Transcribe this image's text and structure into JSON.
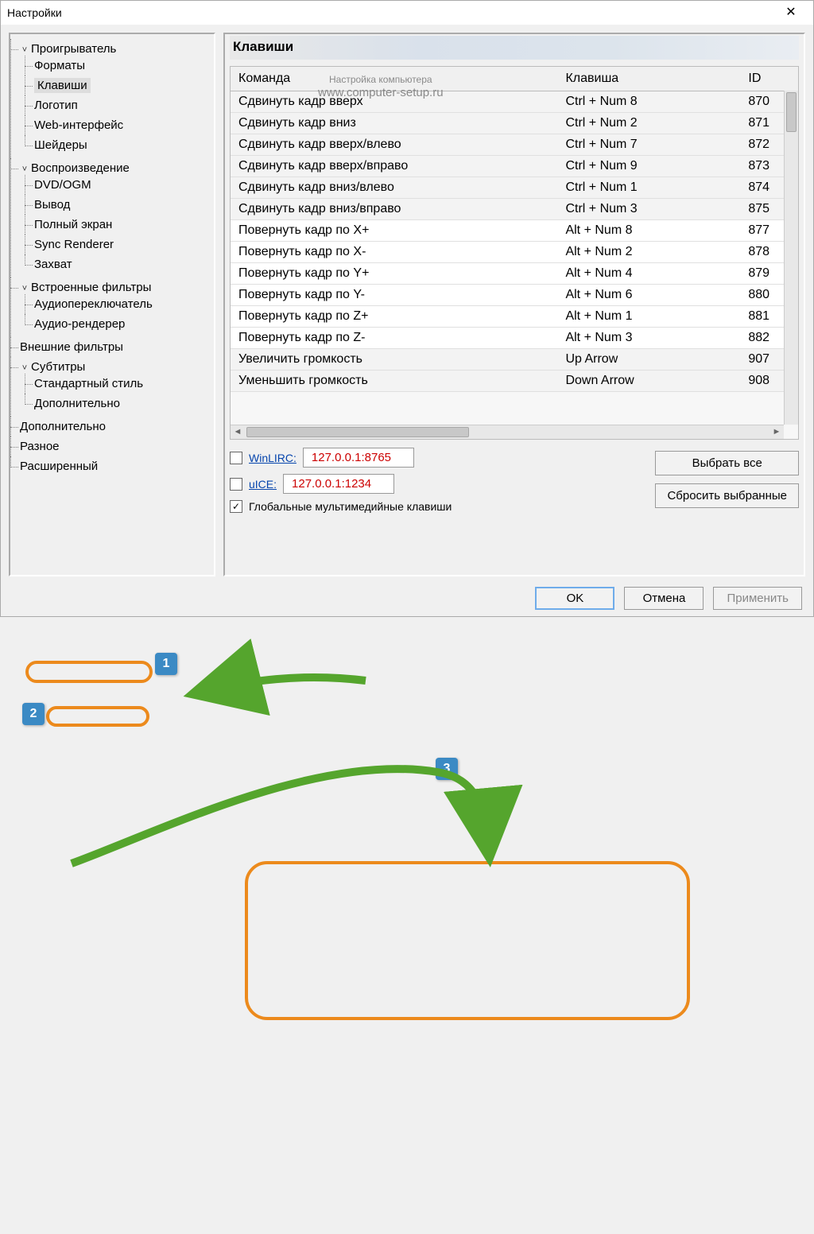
{
  "window": {
    "title": "Настройки"
  },
  "watermark": {
    "line1": "Настройка компьютера",
    "line2": "www.computer-setup.ru"
  },
  "tree": {
    "player": "Проигрыватель",
    "formats": "Форматы",
    "keys": "Клавиши",
    "logo": "Логотип",
    "web": "Web-интерфейс",
    "shaders": "Шейдеры",
    "playback": "Воспроизведение",
    "dvd": "DVD/OGM",
    "output": "Вывод",
    "fullscreen": "Полный экран",
    "sync": "Sync Renderer",
    "capture": "Захват",
    "internal_filters": "Встроенные фильтры",
    "audio_switcher": "Аудиопереключатель",
    "audio_renderer": "Аудио-рендерер",
    "external_filters": "Внешние фильтры",
    "subtitles": "Субтитры",
    "default_style": "Стандартный стиль",
    "sub_advanced": "Дополнительно",
    "advanced": "Дополнительно",
    "misc": "Разное",
    "extended": "Расширенный"
  },
  "section": {
    "title": "Клавиши"
  },
  "table": {
    "headers": {
      "command": "Команда",
      "key": "Клавиша",
      "id": "ID"
    },
    "rows": [
      {
        "cmd": "Сдвинуть кадр вверх",
        "key": "Ctrl + Num 8",
        "id": "870"
      },
      {
        "cmd": "Сдвинуть кадр вниз",
        "key": "Ctrl + Num 2",
        "id": "871"
      },
      {
        "cmd": "Сдвинуть кадр вверх/влево",
        "key": "Ctrl + Num 7",
        "id": "872"
      },
      {
        "cmd": "Сдвинуть кадр вверх/вправо",
        "key": "Ctrl + Num 9",
        "id": "873"
      },
      {
        "cmd": "Сдвинуть кадр вниз/влево",
        "key": "Ctrl + Num 1",
        "id": "874"
      },
      {
        "cmd": "Сдвинуть кадр вниз/вправо",
        "key": "Ctrl + Num 3",
        "id": "875"
      },
      {
        "cmd": "Повернуть кадр по X+",
        "key": "Alt + Num 8",
        "id": "877"
      },
      {
        "cmd": "Повернуть кадр по X-",
        "key": "Alt + Num 2",
        "id": "878"
      },
      {
        "cmd": "Повернуть кадр по Y+",
        "key": "Alt + Num 4",
        "id": "879"
      },
      {
        "cmd": "Повернуть кадр по Y-",
        "key": "Alt + Num 6",
        "id": "880"
      },
      {
        "cmd": "Повернуть кадр по Z+",
        "key": "Alt + Num 1",
        "id": "881"
      },
      {
        "cmd": "Повернуть кадр по Z-",
        "key": "Alt + Num 3",
        "id": "882"
      },
      {
        "cmd": "Увеличить громкость",
        "key": "Up Arrow",
        "id": "907"
      },
      {
        "cmd": "Уменьшить громкость",
        "key": "Down Arrow",
        "id": "908"
      }
    ]
  },
  "options": {
    "winlirc_label": "WinLIRC:",
    "winlirc_value": "127.0.0.1:8765",
    "uice_label": "uICE:",
    "uice_value": "127.0.0.1:1234",
    "global_keys": "Глобальные мультимедийные клавиши"
  },
  "buttons": {
    "select_all": "Выбрать все",
    "reset_selected": "Сбросить выбранные",
    "ok": "OK",
    "cancel": "Отмена",
    "apply": "Применить"
  },
  "badges": {
    "b1": "1",
    "b2": "2",
    "b3": "3"
  }
}
